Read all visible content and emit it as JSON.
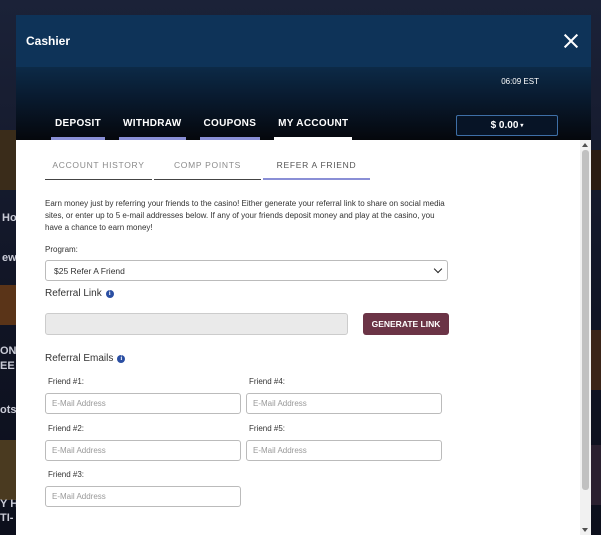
{
  "modal": {
    "title": "Cashier"
  },
  "header": {
    "time": "06:09 EST",
    "tabs": [
      {
        "label": "DEPOSIT"
      },
      {
        "label": "WITHDRAW"
      },
      {
        "label": "COUPONS"
      },
      {
        "label": "MY ACCOUNT",
        "active": true
      }
    ],
    "balance": "$ 0.00"
  },
  "sub_tabs": [
    {
      "label": "ACCOUNT HISTORY"
    },
    {
      "label": "COMP POINTS"
    },
    {
      "label": "REFER A FRIEND",
      "active": true
    }
  ],
  "refer": {
    "intro": "Earn money just by referring your friends to the casino! Either generate your referral link to share on social media sites, or enter up to 5 e-mail addresses below. If any of your friends deposit money and play at the casino, you have a chance to earn money!",
    "program_label": "Program:",
    "program_value": "$25 Refer A Friend",
    "referral_link_title": "Referral Link",
    "referral_link_value": "",
    "generate_button": "GENERATE LINK",
    "referral_emails_title": "Referral Emails",
    "friends": [
      {
        "label": "Friend #1:",
        "placeholder": "E-Mail Address"
      },
      {
        "label": "Friend #2:",
        "placeholder": "E-Mail Address"
      },
      {
        "label": "Friend #3:",
        "placeholder": "E-Mail Address"
      },
      {
        "label": "Friend #4:",
        "placeholder": "E-Mail Address"
      },
      {
        "label": "Friend #5:",
        "placeholder": "E-Mail Address"
      }
    ]
  },
  "background": {
    "left_texts": [
      "Ho",
      "ew",
      "ON",
      "EE",
      "ots",
      "Y H",
      "TI-"
    ]
  },
  "colors": {
    "header_bg": "#0e3358",
    "tab_underline": "#8a8fd6",
    "generate_button_bg": "#6b3446",
    "info_icon": "#2b4fa3"
  }
}
